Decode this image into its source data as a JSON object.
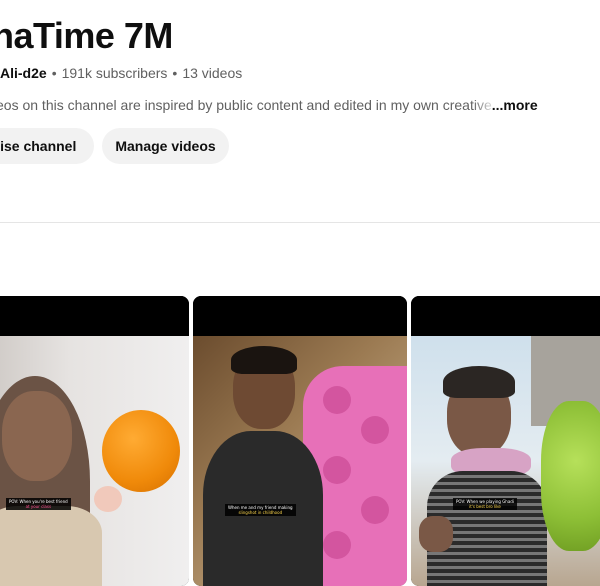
{
  "channel": {
    "title": "naTime 7M",
    "handle": "Ali-d2e",
    "subscribers": "191k subscribers",
    "videos": "13 videos",
    "description_text": "eos on this channel are inspired by public content and edited in my own ",
    "description_fade": "creative",
    "more_label": "...more",
    "separator": "•"
  },
  "buttons": {
    "customise": "mise channel",
    "manage": "Manage videos"
  },
  "shorts": [
    {
      "caption_lines": [
        "POV: When you're best friend",
        "at your class"
      ],
      "caption_small": "deepfake"
    },
    {
      "caption_lines": [
        "When me and my friend making",
        "slingshot in childhood"
      ],
      "caption_small": ""
    },
    {
      "caption_lines": [
        "POV: When we playing Ghadi",
        "it's best bro like"
      ],
      "caption_small": ""
    }
  ]
}
